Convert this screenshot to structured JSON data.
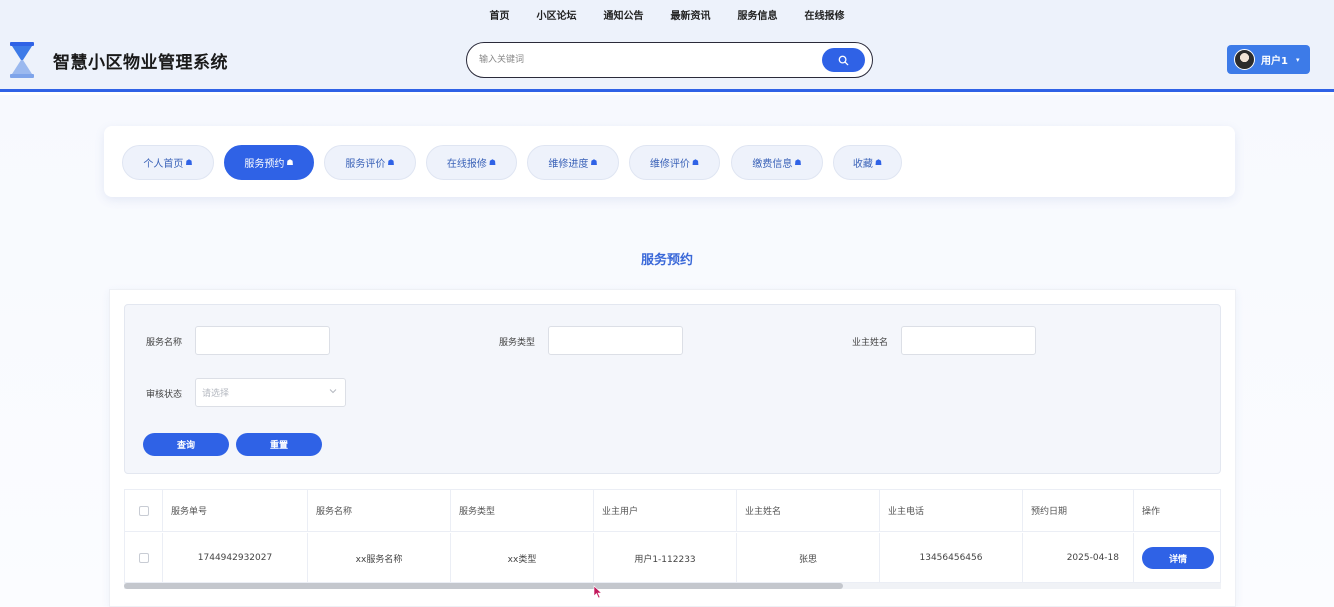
{
  "topnav": [
    "首页",
    "小区论坛",
    "通知公告",
    "最新资讯",
    "服务信息",
    "在线报修"
  ],
  "site_title": "智慧小区物业管理系统",
  "search": {
    "placeholder": "输入关键词"
  },
  "user": {
    "name": "用户1"
  },
  "tabs": [
    {
      "label": "个人首页",
      "active": false
    },
    {
      "label": "服务预约",
      "active": true
    },
    {
      "label": "服务评价",
      "active": false
    },
    {
      "label": "在线报修",
      "active": false
    },
    {
      "label": "维修进度",
      "active": false
    },
    {
      "label": "维修评价",
      "active": false
    },
    {
      "label": "缴费信息",
      "active": false
    },
    {
      "label": "收藏",
      "active": false
    }
  ],
  "section_title": "服务预约",
  "form": {
    "service_name_label": "服务名称",
    "service_type_label": "服务类型",
    "owner_name_label": "业主姓名",
    "audit_status_label": "审核状态",
    "audit_status_placeholder": "请选择",
    "query_label": "查询",
    "reset_label": "重置"
  },
  "table": {
    "headers": [
      "服务单号",
      "服务名称",
      "服务类型",
      "业主用户",
      "业主姓名",
      "业主电话",
      "预约日期",
      "操作"
    ],
    "rows": [
      [
        "1744942932027",
        "xx服务名称",
        "xx类型",
        "用户1-112233",
        "张思",
        "13456456456",
        "2025-04-18",
        "详情"
      ]
    ]
  },
  "colors": {
    "accent": "#2f62e6",
    "title_blue": "#3a68d8",
    "header_bg": "#edf2fb"
  }
}
